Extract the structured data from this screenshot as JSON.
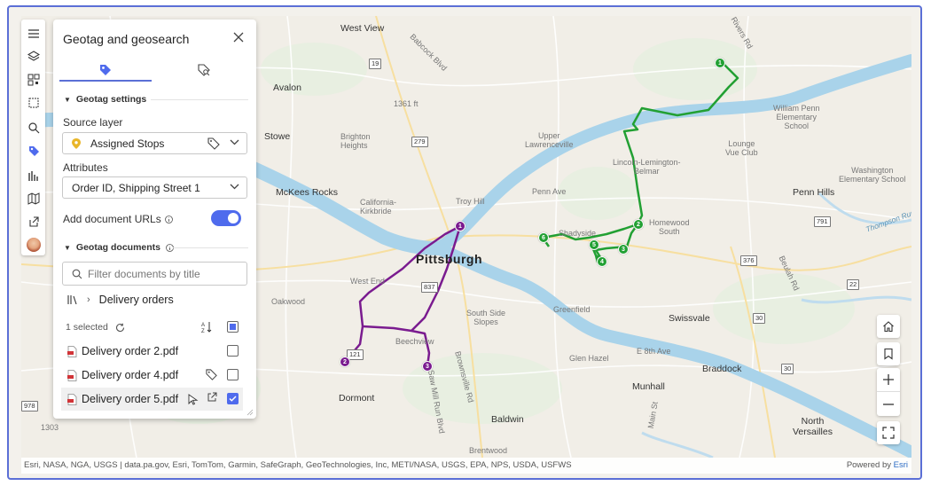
{
  "panel": {
    "title": "Geotag and geosearch",
    "tabs": [
      {
        "icon": "tag-icon",
        "active": true
      },
      {
        "icon": "tag-search-icon",
        "active": false
      }
    ],
    "geotag_settings": {
      "heading": "Geotag settings",
      "source_layer_label": "Source layer",
      "source_layer_value": "Assigned Stops",
      "attributes_label": "Attributes",
      "attributes_value": "Order ID, Shipping Street 1",
      "add_doc_urls_label": "Add document URLs",
      "add_doc_urls_enabled": true
    },
    "geotag_documents": {
      "heading": "Geotag documents",
      "search_placeholder": "Filter documents by title",
      "breadcrumb": "Delivery orders",
      "selected_count": "1 selected",
      "documents": [
        {
          "name": "Delivery order 2.pdf",
          "checked": false
        },
        {
          "name": "Delivery order 4.pdf",
          "checked": false
        },
        {
          "name": "Delivery order 5.pdf",
          "checked": true
        }
      ]
    }
  },
  "toolbar": {
    "items": [
      "menu-icon",
      "layers-icon",
      "qr-icon",
      "select-icon",
      "search-icon",
      "geotag-icon",
      "chart-icon",
      "map-icon",
      "share-icon",
      "avatar"
    ]
  },
  "map": {
    "labels": {
      "west_view": "West View",
      "avalon": "Avalon",
      "stowe": "Stowe",
      "brighton_heights": "Brighton\nHeights",
      "mckees_rocks": "McKees Rocks",
      "california_kirkbride": "California-\nKirkbride",
      "troy_hill": "Troy Hill",
      "upper_lawrenceville": "Upper\nLawrenceville",
      "lincoln_lemington": "Lincoln-Lemington-\nBelmar",
      "penn_ave": "Penn Ave",
      "shadyside": "Shadyside",
      "homewood_south": "Homewood\nSouth",
      "penn_hills": "Penn Hills",
      "william_penn": "William Penn\nElementary\nSchool",
      "lounge_vue": "Lounge\nVue Club",
      "washington_school": "Washington\nElementary School",
      "pittsburgh": "Pittsburgh",
      "west_end": "West End",
      "oakwood": "Oakwood",
      "south_side_slopes": "South Side\nSlopes",
      "greenfield": "Greenfield",
      "swissvale": "Swissvale",
      "beechview": "Beechview",
      "glen_hazel": "Glen Hazel",
      "e_8th_ave": "E 8th Ave",
      "braddock": "Braddock",
      "dormont": "Dormont",
      "munhall": "Munhall",
      "baldwin": "Baldwin",
      "north_versailles": "North\nVersailles",
      "brentwood": "Brentwood",
      "babcock_blvd": "Babcock Blvd",
      "brownsville_rd": "Brownsville Rd",
      "saw_mill_run": "Saw Mill Run Blvd",
      "main_st": "Main St",
      "beulah_rd": "Beulah Rd",
      "thompson_run": "Thompson Run",
      "elev": "1361 ft",
      "elev2": "1303",
      "river_rd": "Rivers Rd"
    },
    "shields": [
      "19",
      "279",
      "837",
      "121",
      "978",
      "376",
      "791",
      "22",
      "30",
      "30",
      "837"
    ],
    "route_purple": {
      "stops": [
        "1",
        "2",
        "3"
      ],
      "color": "#7a1b8f"
    },
    "route_green": {
      "stops": [
        "1",
        "2",
        "3",
        "4",
        "5",
        "6"
      ],
      "color": "#22a033"
    }
  },
  "attribution": {
    "text": "Esri, NASA, NGA, USGS | data.pa.gov, Esri, TomTom, Garmin, SafeGraph, GeoTechnologies, Inc, METI/NASA, USGS, EPA, NPS, USDA, USFWS",
    "powered_prefix": "Powered by",
    "powered_brand": "Esri"
  },
  "colors": {
    "accent": "#4f6bed",
    "water": "#a9d3ea",
    "route_purple": "#7a1b8f",
    "route_green": "#22a033"
  }
}
